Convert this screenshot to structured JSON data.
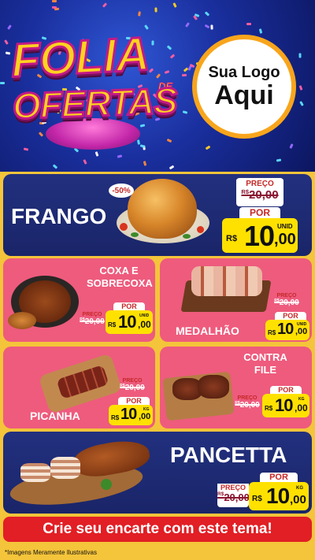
{
  "header": {
    "title_line1": "FOLIA",
    "title_de": "DE",
    "title_line2": "OFERTAS",
    "logo_line1": "Sua Logo",
    "logo_line2": "Aqui"
  },
  "products": {
    "frango": {
      "name": "FRANGO",
      "discount": "-50%",
      "preco_label": "PREÇO",
      "old_currency": "R$",
      "old_price": "20,00",
      "por_label": "POR",
      "currency": "R$",
      "price_int": "10",
      "price_cents": ",00",
      "unit": "UNID"
    },
    "coxa": {
      "name_line1": "COXA E",
      "name_line2": "SOBRECOXA",
      "preco_label": "PREÇO",
      "old_currency": "R$",
      "old_price": "20,00",
      "por_label": "POR",
      "currency": "R$",
      "price_int": "10",
      "price_cents": ",00",
      "unit": "UNID"
    },
    "medalhao": {
      "name": "MEDALHÃO",
      "preco_label": "PREÇO",
      "old_currency": "R$",
      "old_price": "20,00",
      "por_label": "POR",
      "currency": "R$",
      "price_int": "10",
      "price_cents": ",00",
      "unit": "UNID"
    },
    "picanha": {
      "name": "PICANHA",
      "preco_label": "PREÇO",
      "old_currency": "R$",
      "old_price": "20,00",
      "por_label": "POR",
      "currency": "R$",
      "price_int": "10",
      "price_cents": ",00",
      "unit": "KG"
    },
    "contra_file": {
      "name_line1": "CONTRA",
      "name_line2": "FILE",
      "preco_label": "PREÇO",
      "old_currency": "R$",
      "old_price": "20,00",
      "por_label": "POR",
      "currency": "R$",
      "price_int": "10",
      "price_cents": ",00",
      "unit": "KG"
    },
    "pancetta": {
      "name": "PANCETTA",
      "preco_label": "PREÇO",
      "old_currency": "R$",
      "old_price": "20,00",
      "por_label": "POR",
      "currency": "R$",
      "price_int": "10",
      "price_cents": ",00",
      "unit": "KG"
    }
  },
  "banner": {
    "text": "Crie seu encarte com este tema!"
  },
  "footer": {
    "disclaimer": "*Imagens Meramente Ilustrativas"
  },
  "colors": {
    "header_blue": "#1a2f9e",
    "card_blue": "#22307f",
    "card_pink": "#ee5b7d",
    "price_yellow": "#ffe100",
    "accent_red": "#e11f25",
    "background_yellow": "#f4c43a"
  }
}
